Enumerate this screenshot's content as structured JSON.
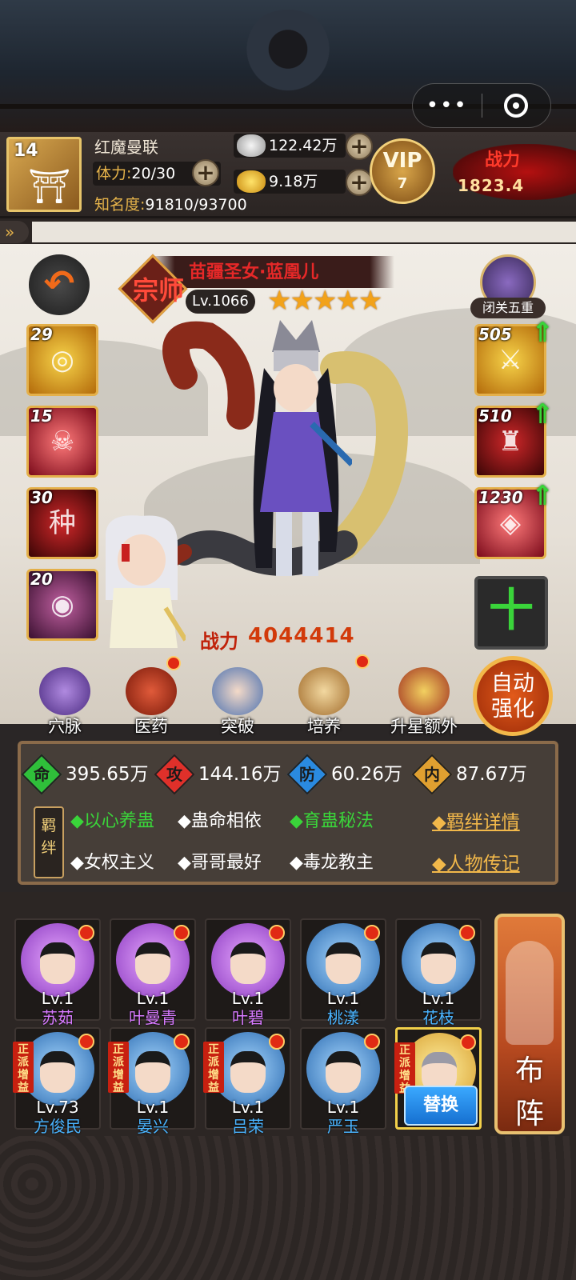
{
  "top_bar": {
    "level": "14",
    "player_name": "红魔曼联",
    "stamina_label": "体力:",
    "stamina_value": "20/30",
    "fame_label": "知名度:",
    "fame_value": "91810/93700",
    "silver": "122.42万",
    "gold": "9.18万",
    "vip_label": "VIP",
    "vip_level": "7",
    "power_label": "战力",
    "power_value": "1823.4",
    "capsule_more": "•••"
  },
  "hero": {
    "title": "苗疆圣女·蓝凰儿",
    "badge": "宗师",
    "level": "Lv.1066",
    "stars": "★★★★★",
    "stars_count": 5,
    "seal_label": "闭关五重",
    "power_label": "战力",
    "power_value": "4044414"
  },
  "skills": [
    {
      "count": "29",
      "icon": "swirl-skill-icon",
      "glyph": "◎"
    },
    {
      "count": "15",
      "icon": "skull-skill-icon",
      "glyph": "☠"
    },
    {
      "count": "30",
      "icon": "seed-skill-icon",
      "glyph": "种"
    },
    {
      "count": "20",
      "icon": "orb-skill-icon",
      "glyph": "◉"
    }
  ],
  "equipment": [
    {
      "count": "505",
      "icon": "weapon-equip-icon",
      "glyph": "⚔"
    },
    {
      "count": "510",
      "icon": "armor-equip-icon",
      "glyph": "♜"
    },
    {
      "count": "1230",
      "icon": "treasure-equip-icon",
      "glyph": "◈"
    }
  ],
  "add_equipment": "十",
  "actions": [
    {
      "label": "穴脉",
      "dot": false
    },
    {
      "label": "医药",
      "dot": true
    },
    {
      "label": "突破",
      "dot": false
    },
    {
      "label": "培养",
      "dot": true
    },
    {
      "label": "升星额外",
      "dot": false
    }
  ],
  "auto_button": {
    "line1": "自动",
    "line2": "强化"
  },
  "stats": [
    {
      "key": "命",
      "value": "395.65万",
      "color": "#2fbf3a"
    },
    {
      "key": "攻",
      "value": "144.16万",
      "color": "#e0302a"
    },
    {
      "key": "防",
      "value": "60.26万",
      "color": "#2a8ae0"
    },
    {
      "key": "内",
      "value": "87.67万",
      "color": "#e0a030"
    }
  ],
  "bonds": {
    "badge_line1": "羁",
    "badge_line2": "绊",
    "row1": [
      {
        "text": "◆以心养蛊",
        "active": true
      },
      {
        "text": "◆蛊命相依",
        "active": false
      },
      {
        "text": "◆育蛊秘法",
        "active": true
      }
    ],
    "row2": [
      {
        "text": "◆女权主义",
        "active": false
      },
      {
        "text": "◆哥哥最好",
        "active": false
      },
      {
        "text": "◆毒龙教主",
        "active": false
      }
    ],
    "detail_link": "◆羁绊详情",
    "bio_link": "◆人物传记"
  },
  "team": [
    {
      "level": "Lv.1",
      "name": "苏茹",
      "color": "purple",
      "tag": ""
    },
    {
      "level": "Lv.1",
      "name": "叶曼青",
      "color": "purple",
      "tag": ""
    },
    {
      "level": "Lv.1",
      "name": "叶碧",
      "color": "purple",
      "tag": ""
    },
    {
      "level": "Lv.1",
      "name": "桃漾",
      "color": "blue",
      "tag": ""
    },
    {
      "level": "Lv.1",
      "name": "花枝",
      "color": "blue",
      "tag": ""
    },
    {
      "level": "Lv.73",
      "name": "方俊民",
      "color": "blue",
      "tag": "正派增益"
    },
    {
      "level": "Lv.1",
      "name": "晏兴",
      "color": "blue",
      "tag": "正派增益"
    },
    {
      "level": "Lv.1",
      "name": "吕荣",
      "color": "blue",
      "tag": "正派增益"
    },
    {
      "level": "Lv.1",
      "name": "严玉",
      "color": "blue",
      "tag": ""
    }
  ],
  "replace_slot": {
    "tag": "正派增益",
    "button": "替换"
  },
  "formation": {
    "line1": "布",
    "line2": "阵"
  }
}
